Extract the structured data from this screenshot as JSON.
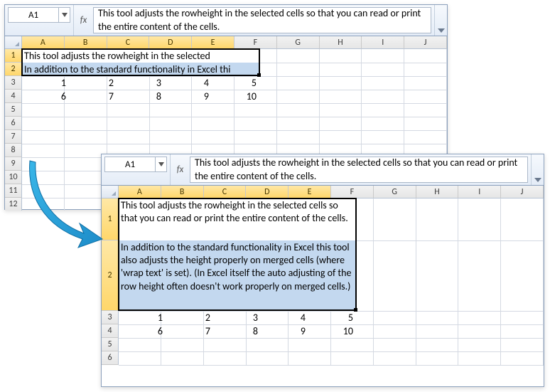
{
  "top": {
    "name_box": "A1",
    "fx_label": "fx",
    "formula_text": "This tool adjusts the rowheight in the selected cells so that you can read or print the entire content of the cells.",
    "columns": [
      "A",
      "B",
      "C",
      "D",
      "E",
      "F",
      "G",
      "H",
      "I",
      "J"
    ],
    "selected_cols": [
      "A",
      "B",
      "C",
      "D",
      "E"
    ],
    "rows": [
      "1",
      "2",
      "3",
      "4",
      "5",
      "6",
      "7",
      "8",
      "9",
      "10",
      "11",
      "12"
    ],
    "selected_rows": [
      "1",
      "2"
    ],
    "row1_merged_text": "This tool adjusts the rowheight in the selected",
    "row2_merged_text": "In addition to the standard functionality in Excel thi",
    "row3_values": [
      "1",
      "2",
      "3",
      "4",
      "5"
    ],
    "row4_values": [
      "6",
      "7",
      "8",
      "9",
      "10"
    ]
  },
  "bottom": {
    "name_box": "A1",
    "fx_label": "fx",
    "formula_text": "This tool adjusts the rowheight in the selected cells so that you can read or print the entire content of the cells.",
    "columns": [
      "A",
      "B",
      "C",
      "D",
      "E",
      "F",
      "G",
      "H",
      "I",
      "J"
    ],
    "selected_cols": [
      "A",
      "B",
      "C",
      "D",
      "E"
    ],
    "rows": [
      "1",
      "2",
      "3",
      "4",
      "5",
      "6"
    ],
    "selected_rows": [
      "1",
      "2"
    ],
    "row1_merged_text": "This tool adjusts the rowheight in the selected cells so that you can read or print the entire content of the cells.",
    "row2_merged_text": "In addition to the standard functionality in Excel this tool also adjusts the height properly on merged cells (where 'wrap text' is set). (In Excel itself the auto adjusting of the row height often doesn't work properly on merged cells.)",
    "row3_values": [
      "1",
      "2",
      "3",
      "4",
      "5"
    ],
    "row4_values": [
      "6",
      "7",
      "8",
      "9",
      "10"
    ]
  }
}
